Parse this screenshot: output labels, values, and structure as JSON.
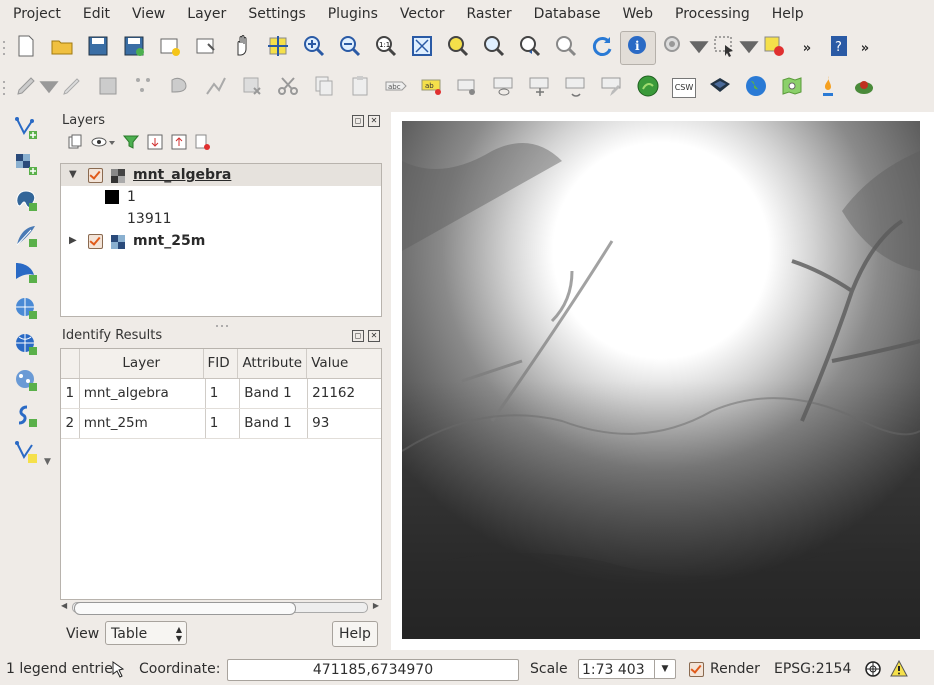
{
  "menubar": {
    "items": [
      "Project",
      "Edit",
      "View",
      "Layer",
      "Settings",
      "Plugins",
      "Vector",
      "Raster",
      "Database",
      "Web",
      "Processing",
      "Help"
    ]
  },
  "toolbar1": {
    "icons": [
      "new-project-icon",
      "open-project-icon",
      "save-project-icon",
      "save-as-icon",
      "new-print-composer-icon",
      "composer-manager-icon",
      "pan-icon",
      "pan-to-selection-icon",
      "zoom-in-icon",
      "zoom-out-icon",
      "zoom-actual-icon",
      "zoom-full-icon",
      "zoom-to-selection-icon",
      "zoom-to-layer-icon",
      "zoom-last-icon",
      "zoom-next-icon",
      "refresh-icon",
      "identify-icon",
      "action-icon",
      "select-icon",
      "deselect-icon",
      "help-icon"
    ],
    "overflow": "»"
  },
  "toolbar2": {
    "icons": [
      "current-edits-icon",
      "toggle-editing-icon",
      "save-edits-icon",
      "add-feature-icon",
      "move-feature-icon",
      "node-tool-icon",
      "delete-selected-icon",
      "cut-features-icon",
      "copy-features-icon",
      "paste-features-icon",
      "label-icon",
      "label-highlight-icon",
      "pin-label-icon",
      "show-hide-labels-icon",
      "move-label-icon",
      "rotate-label-icon",
      "change-label-icon",
      "grass-icon",
      "csw-icon",
      "metasearch-icon",
      "globe-icon",
      "georeferencer-icon",
      "heatmap-icon",
      "python-icon"
    ],
    "csw_label": "CSW"
  },
  "leftbar": {
    "icons": [
      "add-vector-layer-icon",
      "add-raster-layer-icon",
      "add-postgis-layer-icon",
      "add-spatialite-layer-icon",
      "add-mssql-layer-icon",
      "add-wms-layer-icon",
      "add-wcs-layer-icon",
      "add-wfs-layer-icon",
      "add-delimited-text-icon",
      "new-shapefile-icon"
    ]
  },
  "layers_panel": {
    "title": "Layers",
    "toolbar_icons": [
      "add-group-icon",
      "manage-visibility-icon",
      "filter-legend-icon",
      "expand-all-icon",
      "collapse-all-icon",
      "remove-layer-icon"
    ],
    "layers": [
      {
        "name": "mnt_algebra",
        "expanded": true,
        "checked": true,
        "selected": true,
        "legend": [
          "1",
          "13911"
        ]
      },
      {
        "name": "mnt_25m",
        "expanded": false,
        "checked": true,
        "selected": false
      }
    ]
  },
  "identify_panel": {
    "title": "Identify Results",
    "columns": [
      "",
      "Layer",
      "FID",
      "Attribute",
      "Value"
    ],
    "rows": [
      [
        "1",
        "mnt_algebra",
        "1",
        "Band 1",
        "21162"
      ],
      [
        "2",
        "mnt_25m",
        "1",
        "Band 1",
        "93"
      ]
    ],
    "view_label": "View",
    "view_value": "Table",
    "help_label": "Help"
  },
  "statusbar": {
    "legend_entries": "1 legend entrie",
    "coordinate_label": "Coordinate:",
    "coordinate_value": "471185,6734970",
    "scale_label": "Scale",
    "scale_value": "1:73 403",
    "render_label": "Render",
    "crs": "EPSG:2154"
  },
  "colors": {
    "window_bg": "#efebe7",
    "checkbox_accent": "#e05a1a",
    "selected_row": "#e6e2dd"
  }
}
